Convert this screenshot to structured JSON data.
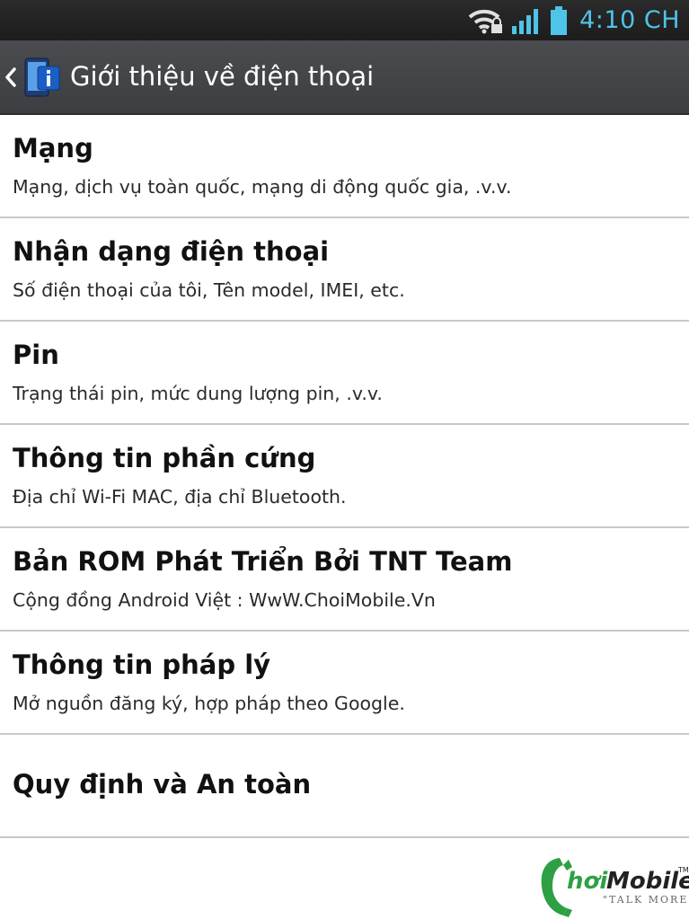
{
  "status_bar": {
    "time": "4:10 CH",
    "icons": [
      "wifi-lock-icon",
      "signal-icon",
      "battery-icon"
    ],
    "accent_color": "#4fc3e8"
  },
  "action_bar": {
    "title": "Giới thiệu về điện thoại",
    "back_icon": "chevron-left-icon",
    "app_icon": "phone-info-icon"
  },
  "items": [
    {
      "title": "Mạng",
      "summary": "Mạng, dịch vụ toàn quốc, mạng di động quốc gia, .v.v."
    },
    {
      "title": "Nhận dạng điện thoại",
      "summary": "Số điện thoại của tôi, Tên model, IMEI, etc."
    },
    {
      "title": "Pin",
      "summary": "Trạng thái pin, mức dung lượng pin, .v.v."
    },
    {
      "title": "Thông tin phần cứng",
      "summary": "Địa chỉ Wi-Fi MAC, địa chỉ Bluetooth."
    },
    {
      "title": "Bản ROM Phát Triển Bởi TNT Team",
      "summary": "Cộng đồng Android Việt : WwW.ChoiMobile.Vn"
    },
    {
      "title": "Thông tin pháp lý",
      "summary": "Mở nguồn đăng ký, hợp pháp theo Google."
    },
    {
      "title": "Quy định và An toàn"
    }
  ],
  "watermark": {
    "brand": "ChoiMobile",
    "tagline": "TALK MORE",
    "tm": "TM"
  }
}
